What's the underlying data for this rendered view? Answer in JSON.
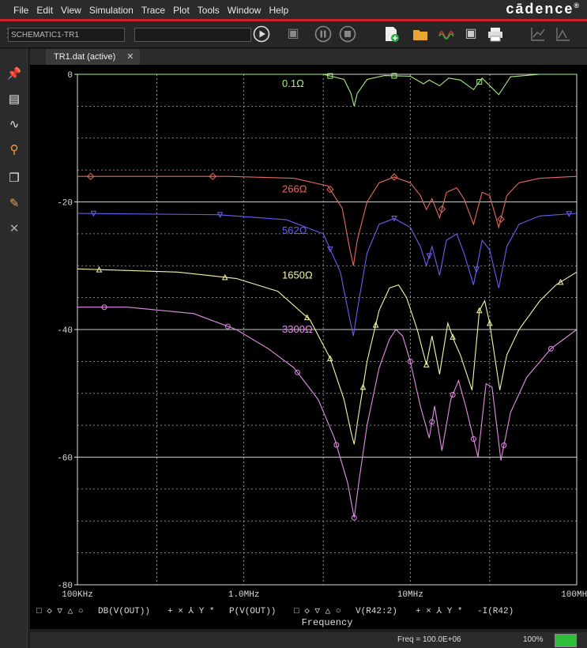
{
  "menu": [
    "File",
    "Edit",
    "View",
    "Simulation",
    "Trace",
    "Plot",
    "Tools",
    "Window",
    "Help"
  ],
  "brand": "cādence",
  "brand_mark": "®",
  "toolbar": {
    "profile_value": "SCHEMATIC1-TR1",
    "search_value": ""
  },
  "tab": {
    "label": "TR1.dat (active)",
    "close": "✕"
  },
  "status": {
    "freq": "Freq = 100.0E+06",
    "zoom": "100%"
  },
  "chart_data": {
    "type": "line",
    "xscale": "log",
    "xlim": [
      100000,
      100000000
    ],
    "ylim": [
      -80,
      0
    ],
    "xlabel": "Frequency",
    "xtick_values": [
      100000,
      1000000,
      10000000,
      100000000
    ],
    "xtick_labels": [
      "100KHz",
      "1.0MHz",
      "10MHz",
      "100MHz"
    ],
    "ytick_values": [
      0,
      -20,
      -40,
      -60,
      -80
    ],
    "ytick_labels": [
      "0",
      "-20",
      "-40",
      "-60",
      "-80"
    ],
    "grid": true,
    "legend_row": {
      "g1_markers": [
        "□",
        "◇",
        "▽",
        "△",
        "○"
      ],
      "g1_label": "DB(V(OUT))",
      "g2_markers": [
        "+",
        "×",
        "⅄",
        "Y",
        "*"
      ],
      "g2_label": "P(V(OUT))",
      "g3_markers": [
        "□",
        "◇",
        "▽",
        "△",
        "○"
      ],
      "g3_label": "V(R42:2)",
      "g4_markers": [
        "+",
        "×",
        "⅄",
        "Y",
        "*"
      ],
      "g4_label": "-I(R42)"
    },
    "series": [
      {
        "label": "0.1Ω",
        "color": "#a6f07a",
        "marker": "square",
        "points": [
          [
            100000,
            0
          ],
          [
            3000000,
            0
          ],
          [
            4000000,
            -0.8
          ],
          [
            4400000,
            -3
          ],
          [
            4600000,
            -5
          ],
          [
            4800000,
            -3
          ],
          [
            5500000,
            -0.8
          ],
          [
            7000000,
            -0.2
          ],
          [
            10000000,
            -0.3
          ],
          [
            12000000,
            -1.5
          ],
          [
            13000000,
            -0.9
          ],
          [
            15000000,
            -1.8
          ],
          [
            17000000,
            -0.6
          ],
          [
            20000000,
            -0.9
          ],
          [
            24000000,
            -2.4
          ],
          [
            27000000,
            -0.6
          ],
          [
            34000000,
            -3.2
          ],
          [
            40000000,
            -0.4
          ],
          [
            60000000,
            0
          ],
          [
            100000000,
            0
          ]
        ],
        "markers_x": [
          3300000,
          8000000,
          26000000
        ]
      },
      {
        "label": "266Ω",
        "color": "#e86a5e",
        "marker": "diamond",
        "points": [
          [
            100000,
            -16
          ],
          [
            800000,
            -16
          ],
          [
            2000000,
            -16.3
          ],
          [
            3200000,
            -17.5
          ],
          [
            3900000,
            -21
          ],
          [
            4300000,
            -27
          ],
          [
            4550000,
            -30
          ],
          [
            4800000,
            -26
          ],
          [
            5500000,
            -20
          ],
          [
            6500000,
            -17
          ],
          [
            8000000,
            -16.1
          ],
          [
            10000000,
            -17
          ],
          [
            11500000,
            -19
          ],
          [
            12500000,
            -21.2
          ],
          [
            13500000,
            -19.5
          ],
          [
            15000000,
            -22.5
          ],
          [
            16500000,
            -18.5
          ],
          [
            19000000,
            -17.8
          ],
          [
            21000000,
            -19.5
          ],
          [
            24000000,
            -23.5
          ],
          [
            27000000,
            -18.5
          ],
          [
            30000000,
            -19
          ],
          [
            34000000,
            -24
          ],
          [
            38000000,
            -19
          ],
          [
            45000000,
            -17
          ],
          [
            60000000,
            -16.3
          ],
          [
            100000000,
            -16
          ]
        ],
        "markers_x": [
          120000,
          650000,
          3300000,
          8000000,
          15500000,
          35000000
        ]
      },
      {
        "label": "562Ω",
        "color": "#6a5ef2",
        "marker": "tri-down",
        "points": [
          [
            100000,
            -21.8
          ],
          [
            700000,
            -22
          ],
          [
            1800000,
            -22.8
          ],
          [
            3000000,
            -25
          ],
          [
            3800000,
            -31
          ],
          [
            4300000,
            -38
          ],
          [
            4550000,
            -41
          ],
          [
            4800000,
            -37
          ],
          [
            5500000,
            -28
          ],
          [
            6500000,
            -23.5
          ],
          [
            8000000,
            -22.6
          ],
          [
            10000000,
            -24
          ],
          [
            11500000,
            -27
          ],
          [
            12500000,
            -30
          ],
          [
            13500000,
            -27
          ],
          [
            15000000,
            -31.5
          ],
          [
            16500000,
            -26
          ],
          [
            19000000,
            -25
          ],
          [
            21000000,
            -28
          ],
          [
            24000000,
            -33
          ],
          [
            27000000,
            -26
          ],
          [
            30000000,
            -27.5
          ],
          [
            34000000,
            -33.5
          ],
          [
            38000000,
            -27
          ],
          [
            45000000,
            -23.5
          ],
          [
            60000000,
            -22.2
          ],
          [
            100000000,
            -21.8
          ]
        ],
        "markers_x": [
          125000,
          720000,
          3300000,
          8000000,
          13000000,
          25000000,
          90000000
        ]
      },
      {
        "label": "1650Ω",
        "color": "#f7f7a8",
        "marker": "tri-up",
        "points": [
          [
            100000,
            -30.5
          ],
          [
            400000,
            -31
          ],
          [
            900000,
            -32
          ],
          [
            1600000,
            -34
          ],
          [
            2500000,
            -38.5
          ],
          [
            3300000,
            -44.5
          ],
          [
            4000000,
            -51
          ],
          [
            4400000,
            -56
          ],
          [
            4600000,
            -58
          ],
          [
            4850000,
            -54
          ],
          [
            5500000,
            -45
          ],
          [
            6500000,
            -37
          ],
          [
            7500000,
            -33.5
          ],
          [
            8500000,
            -33
          ],
          [
            9500000,
            -35
          ],
          [
            11000000,
            -40
          ],
          [
            12500000,
            -45.5
          ],
          [
            13500000,
            -41
          ],
          [
            15000000,
            -47
          ],
          [
            16800000,
            -39
          ],
          [
            18500000,
            -42
          ],
          [
            20000000,
            -44
          ],
          [
            23500000,
            -49.5
          ],
          [
            26000000,
            -37
          ],
          [
            28000000,
            -35.5
          ],
          [
            30000000,
            -39
          ],
          [
            34500000,
            -49.5
          ],
          [
            38000000,
            -44
          ],
          [
            45000000,
            -40
          ],
          [
            60000000,
            -35.5
          ],
          [
            75000000,
            -33
          ],
          [
            100000000,
            -31
          ]
        ],
        "markers_x": [
          135000,
          770000,
          2400000,
          3300000,
          5200000,
          6200000,
          12500000,
          18000000,
          26000000,
          30000000,
          80000000
        ]
      },
      {
        "label": "3300Ω",
        "color": "#e58ee8",
        "marker": "circle",
        "points": [
          [
            100000,
            -36.5
          ],
          [
            200000,
            -36.5
          ],
          [
            500000,
            -37.5
          ],
          [
            900000,
            -40
          ],
          [
            1400000,
            -43
          ],
          [
            2000000,
            -46
          ],
          [
            2800000,
            -51
          ],
          [
            3500000,
            -57
          ],
          [
            4200000,
            -64
          ],
          [
            4600000,
            -69.5
          ],
          [
            4900000,
            -64
          ],
          [
            5500000,
            -55
          ],
          [
            6500000,
            -46
          ],
          [
            7500000,
            -41.5
          ],
          [
            8200000,
            -40
          ],
          [
            9000000,
            -41
          ],
          [
            10000000,
            -45
          ],
          [
            11500000,
            -52
          ],
          [
            13000000,
            -57
          ],
          [
            14000000,
            -52
          ],
          [
            15500000,
            -59
          ],
          [
            17500000,
            -51
          ],
          [
            19500000,
            -48
          ],
          [
            21500000,
            -52
          ],
          [
            25500000,
            -60
          ],
          [
            28500000,
            -48.5
          ],
          [
            31000000,
            -49
          ],
          [
            35000000,
            -60.5
          ],
          [
            40000000,
            -53
          ],
          [
            50000000,
            -47.5
          ],
          [
            70000000,
            -43
          ],
          [
            100000000,
            -40
          ]
        ],
        "markers_x": [
          145000,
          800000,
          2100000,
          3600000,
          4600000,
          10000000,
          13500000,
          18000000,
          24000000,
          36500000,
          70000000
        ]
      }
    ],
    "series_label_x": [
      6300000,
      6300000,
      6300000,
      6300000,
      6300000
    ],
    "series_label_y": [
      -1.5,
      -18,
      -24.5,
      -31.5,
      -40
    ]
  }
}
